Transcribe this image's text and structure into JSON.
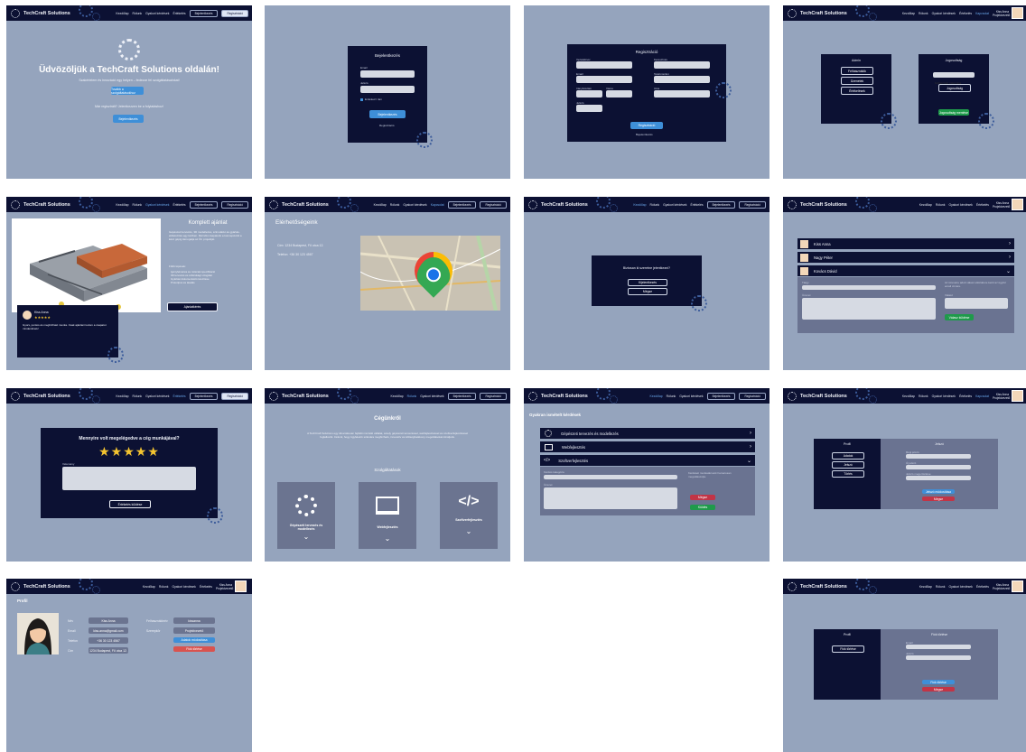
{
  "nav": {
    "brand": "TechCraft Solutions",
    "links": [
      "Kezdőlap",
      "Rólunk",
      "Gyakori kérdések",
      "Értékelés",
      "Kapcsolat"
    ],
    "login": "Bejelentkezés",
    "register": "Regisztráció",
    "user_name": "Kiss Anna Projektvezető"
  },
  "home": {
    "title": "Üdvözöljük a TechCraft Solutions oldalán!",
    "subtitle": "Szakértelem és innováció egy helyen – fedezze fel szolgáltatásainkat!",
    "btn1": "Tovább a szolgáltatásokhoz",
    "text2": "Már regisztrált? Jelentkezzen be a folytatáshoz!",
    "btn2": "Bejelentkezés"
  },
  "login": {
    "title": "Bejelentkezés",
    "email": "Email",
    "password": "Jelszó",
    "remember": "Emlékezz rám",
    "submit": "Bejelentkezés",
    "register": "Regisztráció"
  },
  "register": {
    "title": "Regisztráció",
    "fields": [
      "Vezetéknév",
      "Keresztnév",
      "Email",
      "Telefonszám",
      "Irányítószám",
      "Város",
      "Utca",
      "Jelszó"
    ],
    "submit": "Regisztráció",
    "back": "Bejelentkezés"
  },
  "admin": {
    "left_title": "Admin",
    "left_btns": [
      "Felhasználók",
      "Üzenetek",
      "Értékelések"
    ],
    "right_title": "Jogosultság",
    "select": "Felhasználó választása",
    "btn": "Jogosultság",
    "save": "Jogosultság mentése"
  },
  "about_project": {
    "title": "Komplett ajánlat",
    "desc": "Gépészeti tervezés, 3D modellezés, szimuláció és gyártás-előkészítés egy kézben. Mérnöki csapatunk a koncepciótól a kész gépig támogatja az Ön projektjét.",
    "list_title": "Főbb lépések:",
    "list": [
      "Igényfelmérés és műszaki specifikáció",
      "3D tervezés és szilárdsági vizsgálat",
      "Gyártási dokumentáció készítése",
      "Prototípus és átadás"
    ],
    "btn": "Ajánlatkérés",
    "review_name": "Kiss Anna",
    "review_stars": "★★★★★",
    "review_text": "Gyors, pontos és megbízható munka. Csak ajánlani tudom a csapatot mindenkinek!"
  },
  "contact": {
    "title": "Elérhetőségeink",
    "address": "Cím: 1234 Budapest, Fő utca 12.",
    "phone": "Telefon: +36 30 123 4567"
  },
  "logout": {
    "question": "Biztosan ki szeretne jelentkezni?",
    "yes": "Kijelentkezés",
    "no": "Mégse"
  },
  "messages": {
    "users": [
      "Kiss Anna",
      "Nagy Péter",
      "Kovács Dávid"
    ],
    "field1": "Tárgy",
    "field2": "Üzenet",
    "side_text": "Az üzenetre adott válasz elküldésre kerül az ügyfél email címére.",
    "reply_label": "Válasz",
    "send": "Válasz küldése"
  },
  "rating": {
    "question": "Mennyire volt megelégedve a cég munkájával?",
    "stars": "★★★★★",
    "label": "Vélemény",
    "submit": "Értékelés küldése"
  },
  "company": {
    "title": "Cégünkről",
    "desc": "A TechCraft Solutions egy dinamikusan fejlődő mérnöki vállalat, amely gépészeti tervezéssel, webfejlesztéssel és szoftverfejlesztéssel foglalkozik. Célunk, hogy ügyfeleink számára megbízható, innovatív és költséghatékony megoldásokat kínáljunk.",
    "services_title": "Szolgáltatások",
    "services": [
      "Gépészeti tervezés és modellezés",
      "Webfejlesztés",
      "Szoftverfejlesztés"
    ]
  },
  "faq": {
    "title": "Gyakran ismételt kérdések",
    "rows": [
      "Gépészeti tervezés és modellezés",
      "Webfejlesztés",
      "Szoftverfejlesztés"
    ],
    "select_label": "Kérdés kategória",
    "msg_label": "Üzenet",
    "side": "Kérdését munkatársunk hamarosan megválaszolja.",
    "cancel": "Mégse",
    "send": "Küldés"
  },
  "password": {
    "left_title": "Profil",
    "left_btns": [
      "Adatok",
      "Jelszó",
      "Törlés"
    ],
    "right_title": "Jelszó",
    "fields": [
      "Régi jelszó",
      "Új jelszó",
      "Jelszó megerősítése"
    ],
    "save": "Jelszó módosítása",
    "cancel": "Mégse"
  },
  "profile": {
    "title": "Profil",
    "rows": [
      {
        "label": "Név",
        "value": "Kiss Anna"
      },
      {
        "label": "Email",
        "value": "kiss.anna@gmail.com"
      },
      {
        "label": "Telefon",
        "value": "+36 30 123 4567"
      },
      {
        "label": "Cím",
        "value": "1234 Budapest, Fő utca 12."
      }
    ],
    "right_rows": [
      {
        "label": "Felhasználónév",
        "value": "kissanna"
      },
      {
        "label": "Szerepkör",
        "value": "Projektvezető"
      }
    ],
    "edit": "Adatok módosítása",
    "delete": "Fiók törlése"
  },
  "delete": {
    "left_title": "Profil",
    "left_btn": "Fiók törlése",
    "right_title": "Fiók törlése",
    "fields": [
      "Email",
      "Jelszó"
    ],
    "confirm": "Fiók törlése",
    "cancel": "Mégse"
  }
}
